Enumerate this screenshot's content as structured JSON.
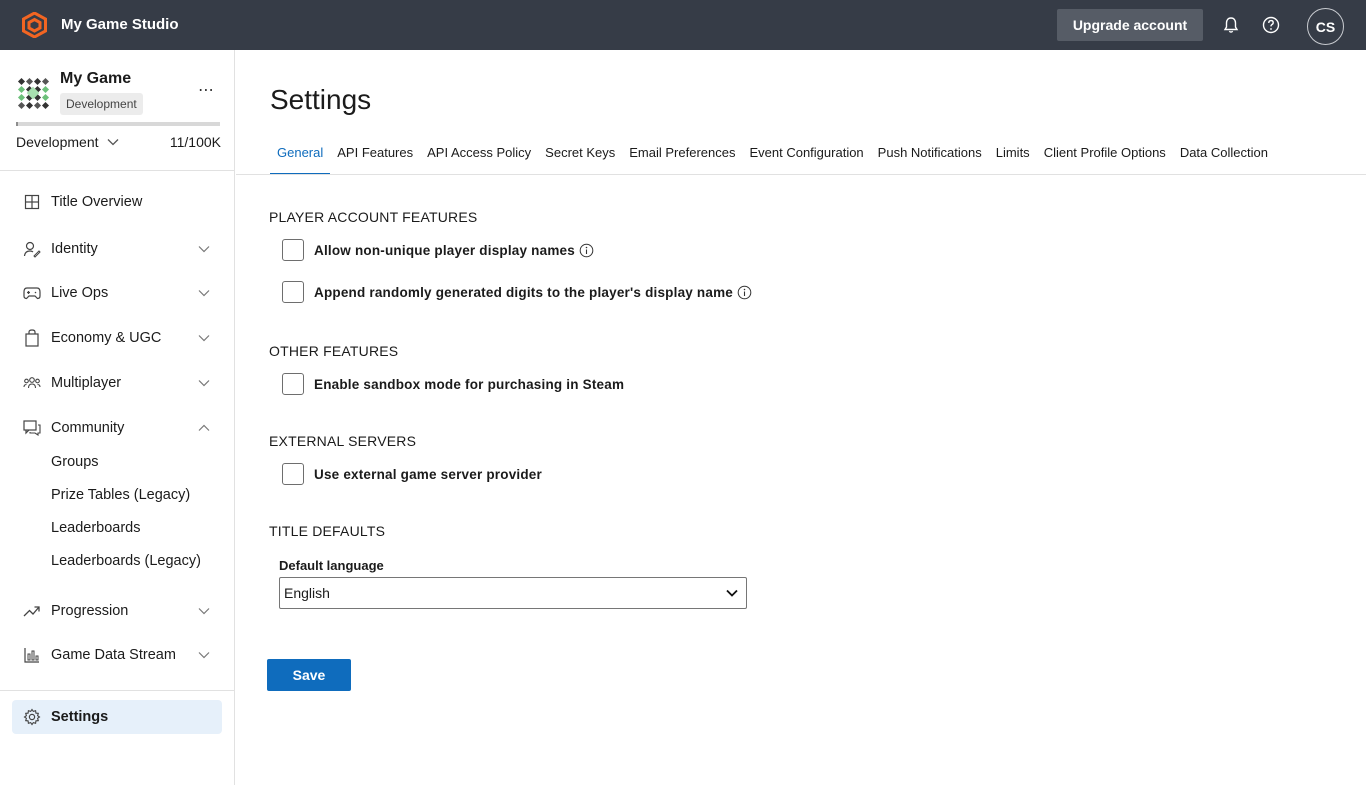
{
  "header": {
    "studio_name": "My Game Studio",
    "upgrade_label": "Upgrade account",
    "avatar_initials": "CS",
    "bar_color": "#363c47",
    "logo_color": "#f26522"
  },
  "sidebar": {
    "game_name": "My Game",
    "environment_badge": "Development",
    "environment_select": "Development",
    "usage_count": "11/100K",
    "usage_fraction": 0.00011,
    "nav": [
      {
        "label": "Title Overview",
        "icon": "grid-icon",
        "expandable": false
      },
      {
        "label": "Identity",
        "icon": "user-icon",
        "expandable": true,
        "expanded": false
      },
      {
        "label": "Live Ops",
        "icon": "gamepad-icon",
        "expandable": true,
        "expanded": false
      },
      {
        "label": "Economy & UGC",
        "icon": "shopping-bag-icon",
        "expandable": true,
        "expanded": false
      },
      {
        "label": "Multiplayer",
        "icon": "people-icon",
        "expandable": true,
        "expanded": false
      },
      {
        "label": "Community",
        "icon": "chat-icon",
        "expandable": true,
        "expanded": true
      },
      {
        "label": "Progression",
        "icon": "trending-up-icon",
        "expandable": true,
        "expanded": false
      },
      {
        "label": "Game Data Stream",
        "icon": "bar-chart-icon",
        "expandable": true,
        "expanded": false
      }
    ],
    "community_sub": [
      "Groups",
      "Prize Tables (Legacy)",
      "Leaderboards",
      "Leaderboards (Legacy)"
    ],
    "settings_label": "Settings",
    "active_color": "#e6f0fa"
  },
  "main": {
    "title": "Settings",
    "tabs": [
      "General",
      "API Features",
      "API Access Policy",
      "Secret Keys",
      "Email Preferences",
      "Event Configuration",
      "Push Notifications",
      "Limits",
      "Client Profile Options",
      "Data Collection"
    ],
    "active_tab": "General",
    "accent_color": "#0f6cbd",
    "sections": {
      "player_account": {
        "title": "PLAYER ACCOUNT FEATURES",
        "options": [
          {
            "label": "Allow non-unique player display names",
            "checked": false,
            "info": true
          },
          {
            "label": "Append randomly generated digits to the player's display name",
            "checked": false,
            "info": true
          }
        ]
      },
      "other": {
        "title": "OTHER FEATURES",
        "options": [
          {
            "label": "Enable sandbox mode for purchasing in Steam",
            "checked": false
          }
        ]
      },
      "external": {
        "title": "EXTERNAL SERVERS",
        "options": [
          {
            "label": "Use external game server provider",
            "checked": false
          }
        ]
      },
      "title_defaults": {
        "title": "TITLE DEFAULTS",
        "language_label": "Default language",
        "language_value": "English"
      }
    },
    "save_label": "Save"
  }
}
